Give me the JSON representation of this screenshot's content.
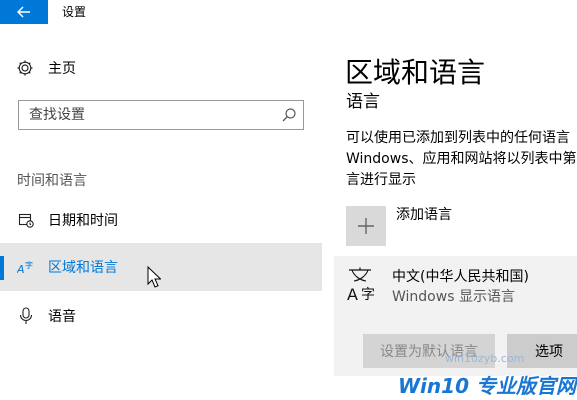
{
  "window": {
    "title": "设置"
  },
  "sidebar": {
    "home_label": "主页",
    "search_placeholder": "查找设置",
    "section_title": "时间和语言",
    "items": [
      {
        "label": "日期和时间",
        "icon": "calendar-clock-icon"
      },
      {
        "label": "区域和语言",
        "icon": "language-icon",
        "selected": true
      },
      {
        "label": "语音",
        "icon": "microphone-icon"
      }
    ]
  },
  "main": {
    "title": "区域和语言",
    "subheading": "语言",
    "description_lines": [
      "可以使用已添加到列表中的任何语言",
      "Windows、应用和网站将以列表中第",
      "言进行显示"
    ],
    "add_language_label": "添加语言",
    "languages": [
      {
        "name": "中文(中华人民共和国)",
        "sub": "Windows 显示语言"
      }
    ],
    "set_default_label": "设置为默认语言",
    "options_label": "选项"
  },
  "watermark": {
    "url": "win10zyb.com",
    "text": "Win10 专业版官网"
  },
  "colors": {
    "accent": "#0078d7",
    "selected_bg": "#e6e6e6",
    "card_bg": "#f2f2f2"
  }
}
